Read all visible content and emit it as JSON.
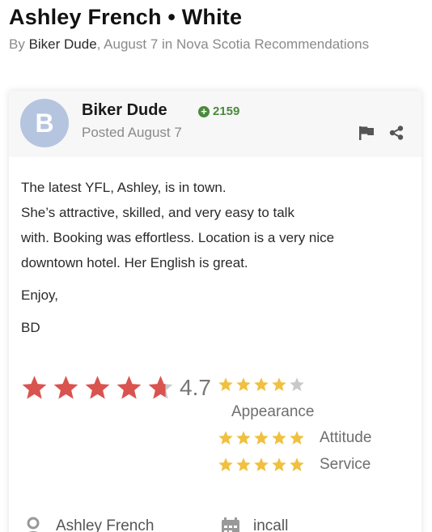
{
  "topic": {
    "title": "Ashley French • White",
    "by_prefix": "By ",
    "author": "Biker Dude",
    "meta_rest": ", August 7 in Nova Scotia Recommendations"
  },
  "post": {
    "avatar_letter": "B",
    "poster_name": "Biker Dude",
    "reputation": "2159",
    "posted": "Posted August 7",
    "lines": [
      "The latest YFL, Ashley, is in town.",
      "She’s attractive, skilled, and very easy to talk",
      "with. Booking was effortless. Location is a very nice",
      "downtown hotel. Her English is great."
    ],
    "signoff": "Enjoy,",
    "signature": "BD"
  },
  "rating": {
    "overall": "4.7",
    "overall_value": 4.7,
    "overall_max": 5,
    "star_color": "#d9534f",
    "sub_star_color": "#f0c040",
    "empty_star_color": "#c9c9c9",
    "appearance_label": "Appearance",
    "appearance_value": 4,
    "attitude_label": "Attitude",
    "attitude_value": 5,
    "service_label": "Service",
    "service_value": 5
  },
  "fields": {
    "name": "Ashley French",
    "type": "incall"
  },
  "icons": {
    "reputation": "plus-circle-icon",
    "flag": "flag-icon",
    "share": "share-icon",
    "person": "person-icon",
    "calendar": "calendar-icon"
  }
}
